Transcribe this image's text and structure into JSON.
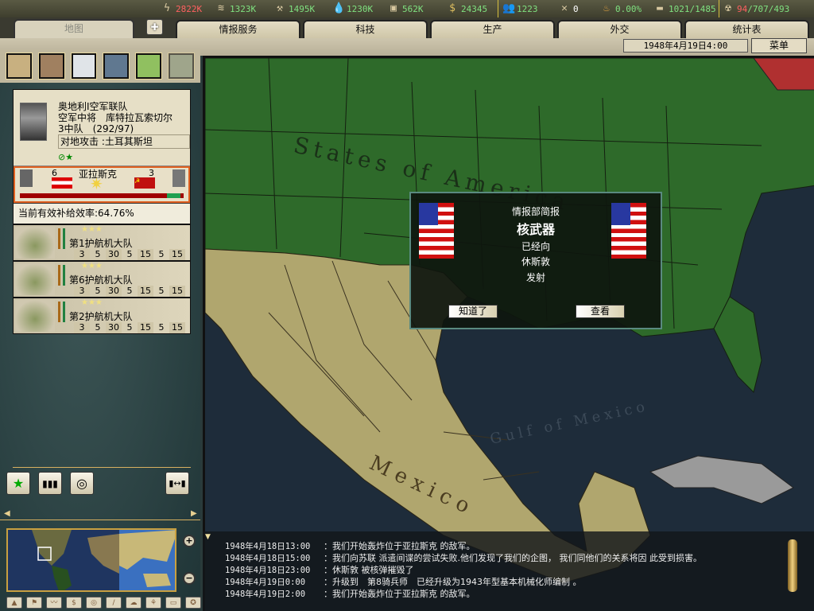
{
  "resources": [
    {
      "icon": "energy-icon",
      "value": "2822K",
      "color": "#ff6060"
    },
    {
      "icon": "metal-icon",
      "value": "1323K",
      "color": "#7fe07f"
    },
    {
      "icon": "rare-materials-icon",
      "value": "1495K",
      "color": "#7fe07f"
    },
    {
      "icon": "oil-icon",
      "value": "1230K",
      "color": "#7fe07f"
    },
    {
      "icon": "supplies-icon",
      "value": "562K",
      "color": "#7fe07f"
    },
    {
      "icon": "money-icon",
      "value": "24345",
      "color": "#7fe07f"
    },
    {
      "icon": "manpower-icon",
      "value": "1223",
      "color": "#7fe07f"
    },
    {
      "icon": "transports-icon",
      "value": "0",
      "color": "#ffffff"
    },
    {
      "icon": "dissent-icon",
      "value": "0.00%",
      "color": "#7fe07f"
    },
    {
      "icon": "convoy-icon",
      "value": "1021/1485",
      "color": "#7fe07f"
    },
    {
      "icon": "nukes-icon",
      "value_red": "94",
      "value": "/707/493",
      "color": "#7fe07f"
    }
  ],
  "tabs": {
    "map": "地图",
    "intel": "情报服务",
    "tech": "科技",
    "production": "生产",
    "diplomacy": "外交",
    "stats": "统计表"
  },
  "date": "1948年4月19日4:00",
  "menu": "菜单",
  "unit": {
    "name": "奥地利I空军联队",
    "leader": "空军中将　库特拉瓦索切尔",
    "strength": "3中队　(292/97)",
    "mission": "对地攻击 :土耳其斯坦",
    "battle": {
      "location": "亚拉斯克",
      "left_count": "6",
      "right_count": "3",
      "progress": 0.9
    },
    "supply": "当前有效补给效率:64.76%",
    "wings": [
      {
        "name": "第1护航机大队",
        "stats": [
          "3",
          "5",
          "30",
          "5",
          "15",
          "5",
          "15"
        ]
      },
      {
        "name": "第6护航机大队",
        "stats": [
          "3",
          "5",
          "30",
          "5",
          "15",
          "5",
          "15"
        ]
      },
      {
        "name": "第2护航机大队",
        "stats": [
          "3",
          "5",
          "30",
          "5",
          "15",
          "5",
          "15"
        ]
      }
    ]
  },
  "map_labels": {
    "usa": "States of America",
    "gulf": "Gulf of Mexico",
    "mexico": "Mexico"
  },
  "dialog": {
    "header": "情报部简报",
    "title": "核武器",
    "line1": "已经向",
    "line2": "休斯敦",
    "line3": "发射",
    "ok": "知道了",
    "view": "查看"
  },
  "log": [
    {
      "time": "1948年4月18日13:00",
      "msg": "：我们开始轰炸位于亚拉斯克 的敌军。"
    },
    {
      "time": "1948年4月18日15:00",
      "msg": "：我们向苏联 派遣间谍的尝试失败.他们发现了我们的企图， 我们同他们的关系将因 此受到损害。"
    },
    {
      "time": "1948年4月18日23:00",
      "msg": "：休斯敦 被核弹摧毁了"
    },
    {
      "time": "1948年4月19日0:00",
      "msg": "：升级到　第8骑兵师　已经升级为1943年型基本机械化师编制 。"
    },
    {
      "time": "1948年4月19日2:00",
      "msg": "：我们开始轰炸位于亚拉斯克 的敌军。"
    }
  ]
}
